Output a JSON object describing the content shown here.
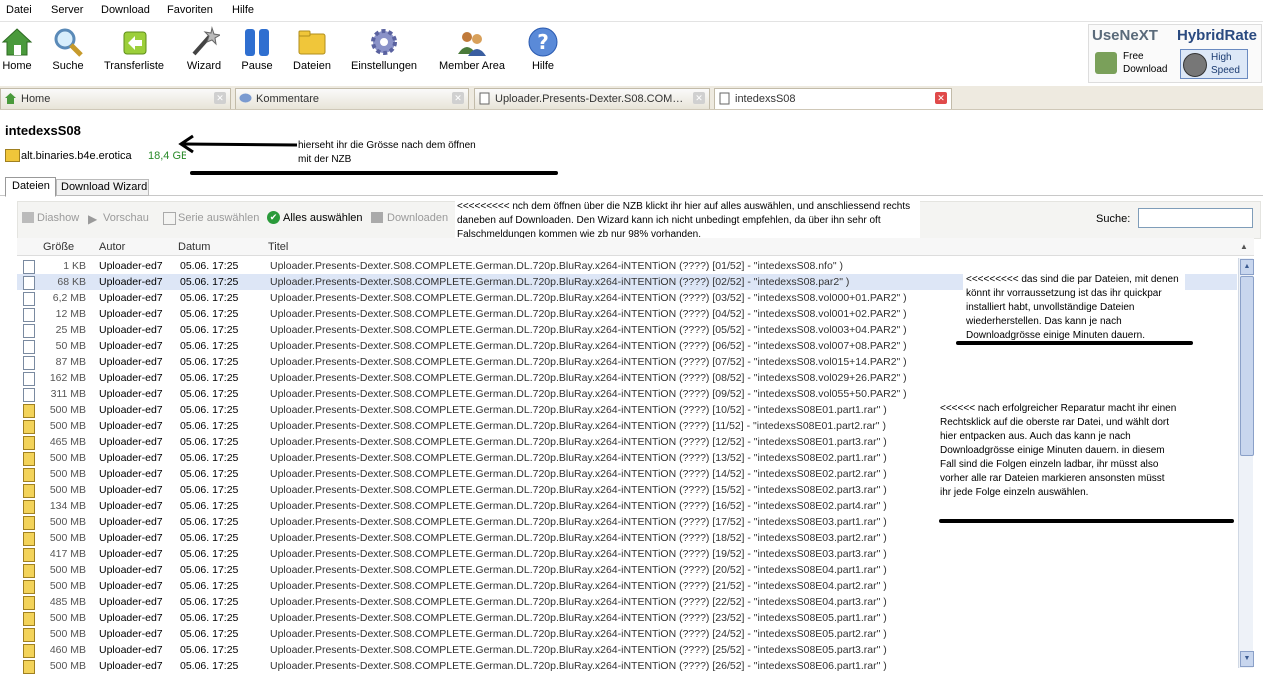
{
  "menu": [
    "Datei",
    "Server",
    "Download",
    "Favoriten",
    "Hilfe"
  ],
  "toolbar": {
    "home": "Home",
    "search": "Suche",
    "transfer": "Transferliste",
    "wizard": "Wizard",
    "pause": "Pause",
    "files": "Dateien",
    "settings": "Einstellungen",
    "member": "Member Area",
    "help": "Hilfe"
  },
  "brand": {
    "logo": "UseNeXT",
    "hybrid": "HybridRate",
    "free": "Free\nDownload",
    "high": "High\nSpeed"
  },
  "tabs": [
    "Home",
    "Kommentare",
    "Uploader.Presents-Dexter.S08.COM…",
    "intedexsS08"
  ],
  "page": {
    "title": "intedexsS08",
    "group": "alt.binaries.b4e.erotica",
    "size": "18,4 GB"
  },
  "subtabs": [
    "Dateien",
    "Download Wizard"
  ],
  "actions": {
    "slideshow": "Diashow",
    "preview": "Vorschau",
    "series": "Serie auswählen",
    "selectall": "Alles auswählen",
    "download": "Downloaden",
    "search_label": "Suche:"
  },
  "columns": {
    "size": "Größe",
    "author": "Autor",
    "date": "Datum",
    "title": "Titel"
  },
  "notes": {
    "size": "hierseht ihr die Grösse nach dem öffnen\nmit der NZB",
    "selectall": "<<<<<<<<< nch dem öffnen über die NZB klickt ihr hier auf alles auswählen, und anschliessend rechts daneben auf Downloaden. Den Wizard kann ich nicht unbedingt empfehlen, da über ihn sehr oft Falschmeldungen kommen wie zb nur 98% vorhanden.",
    "par": "<<<<<<<<< das sind die par Dateien, mit denen könnt ihr vorraussetzung ist das ihr quickpar installiert habt, unvollständige Dateien wiederherstellen. Das kann je nach Downloadgrösse einige Minuten dauern.",
    "rar": "<<<<<< nach erfolgreicher Reparatur macht ihr einen Rechtsklick auf die oberste rar Datei, und wählt dort hier entpacken aus. Auch das kann je nach Downloadgrösse einige Minuten dauern. in diesem Fall sind die  Folgen einzeln ladbar, ihr müsst also vorher alle rar Dateien markieren ansonsten müsst ihr jede Folge einzeln auswählen."
  },
  "rows": [
    {
      "size": "1 KB",
      "author": "Uploader-ed7",
      "date": "05.06. 17:25",
      "title": "Uploader.Presents-Dexter.S08.COMPLETE.German.DL.720p.BluRay.x264-iNTENTiON  (????)  [01/52]  -  \"intedexsS08.nfo\"  )",
      "type": "nfo"
    },
    {
      "size": "68 KB",
      "author": "Uploader-ed7",
      "date": "05.06. 17:25",
      "title": "Uploader.Presents-Dexter.S08.COMPLETE.German.DL.720p.BluRay.x264-iNTENTiON  (????)  [02/52]  -  \"intedexsS08.par2\"  )",
      "type": "par",
      "selected": true
    },
    {
      "size": "6,2 MB",
      "author": "Uploader-ed7",
      "date": "05.06. 17:25",
      "title": "Uploader.Presents-Dexter.S08.COMPLETE.German.DL.720p.BluRay.x264-iNTENTiON  (????)  [03/52]  -  \"intedexsS08.vol000+01.PAR2\"  )",
      "type": "par"
    },
    {
      "size": "12 MB",
      "author": "Uploader-ed7",
      "date": "05.06. 17:25",
      "title": "Uploader.Presents-Dexter.S08.COMPLETE.German.DL.720p.BluRay.x264-iNTENTiON  (????)  [04/52]  -  \"intedexsS08.vol001+02.PAR2\"  )",
      "type": "par"
    },
    {
      "size": "25 MB",
      "author": "Uploader-ed7",
      "date": "05.06. 17:25",
      "title": "Uploader.Presents-Dexter.S08.COMPLETE.German.DL.720p.BluRay.x264-iNTENTiON  (????)  [05/52]  -  \"intedexsS08.vol003+04.PAR2\"  )",
      "type": "par"
    },
    {
      "size": "50 MB",
      "author": "Uploader-ed7",
      "date": "05.06. 17:25",
      "title": "Uploader.Presents-Dexter.S08.COMPLETE.German.DL.720p.BluRay.x264-iNTENTiON  (????)  [06/52]  -  \"intedexsS08.vol007+08.PAR2\"  )",
      "type": "par"
    },
    {
      "size": "87 MB",
      "author": "Uploader-ed7",
      "date": "05.06. 17:25",
      "title": "Uploader.Presents-Dexter.S08.COMPLETE.German.DL.720p.BluRay.x264-iNTENTiON  (????)  [07/52]  -  \"intedexsS08.vol015+14.PAR2\"  )",
      "type": "par"
    },
    {
      "size": "162 MB",
      "author": "Uploader-ed7",
      "date": "05.06. 17:25",
      "title": "Uploader.Presents-Dexter.S08.COMPLETE.German.DL.720p.BluRay.x264-iNTENTiON  (????)  [08/52]  -  \"intedexsS08.vol029+26.PAR2\"  )",
      "type": "par"
    },
    {
      "size": "311 MB",
      "author": "Uploader-ed7",
      "date": "05.06. 17:25",
      "title": "Uploader.Presents-Dexter.S08.COMPLETE.German.DL.720p.BluRay.x264-iNTENTiON  (????)  [09/52]  -  \"intedexsS08.vol055+50.PAR2\"  )",
      "type": "par"
    },
    {
      "size": "500 MB",
      "author": "Uploader-ed7",
      "date": "05.06. 17:25",
      "title": "Uploader.Presents-Dexter.S08.COMPLETE.German.DL.720p.BluRay.x264-iNTENTiON  (????)  [10/52]  -  \"intedexsS08E01.part1.rar\"  )",
      "type": "rar"
    },
    {
      "size": "500 MB",
      "author": "Uploader-ed7",
      "date": "05.06. 17:25",
      "title": "Uploader.Presents-Dexter.S08.COMPLETE.German.DL.720p.BluRay.x264-iNTENTiON  (????)  [11/52]  -  \"intedexsS08E01.part2.rar\"  )",
      "type": "rar"
    },
    {
      "size": "465 MB",
      "author": "Uploader-ed7",
      "date": "05.06. 17:25",
      "title": "Uploader.Presents-Dexter.S08.COMPLETE.German.DL.720p.BluRay.x264-iNTENTiON  (????)  [12/52]  -  \"intedexsS08E01.part3.rar\"  )",
      "type": "rar"
    },
    {
      "size": "500 MB",
      "author": "Uploader-ed7",
      "date": "05.06. 17:25",
      "title": "Uploader.Presents-Dexter.S08.COMPLETE.German.DL.720p.BluRay.x264-iNTENTiON  (????)  [13/52]  -  \"intedexsS08E02.part1.rar\"  )",
      "type": "rar"
    },
    {
      "size": "500 MB",
      "author": "Uploader-ed7",
      "date": "05.06. 17:25",
      "title": "Uploader.Presents-Dexter.S08.COMPLETE.German.DL.720p.BluRay.x264-iNTENTiON  (????)  [14/52]  -  \"intedexsS08E02.part2.rar\"  )",
      "type": "rar"
    },
    {
      "size": "500 MB",
      "author": "Uploader-ed7",
      "date": "05.06. 17:25",
      "title": "Uploader.Presents-Dexter.S08.COMPLETE.German.DL.720p.BluRay.x264-iNTENTiON  (????)  [15/52]  -  \"intedexsS08E02.part3.rar\"  )",
      "type": "rar"
    },
    {
      "size": "134 MB",
      "author": "Uploader-ed7",
      "date": "05.06. 17:25",
      "title": "Uploader.Presents-Dexter.S08.COMPLETE.German.DL.720p.BluRay.x264-iNTENTiON  (????)  [16/52]  -  \"intedexsS08E02.part4.rar\"  )",
      "type": "rar"
    },
    {
      "size": "500 MB",
      "author": "Uploader-ed7",
      "date": "05.06. 17:25",
      "title": "Uploader.Presents-Dexter.S08.COMPLETE.German.DL.720p.BluRay.x264-iNTENTiON  (????)  [17/52]  -  \"intedexsS08E03.part1.rar\"  )",
      "type": "rar"
    },
    {
      "size": "500 MB",
      "author": "Uploader-ed7",
      "date": "05.06. 17:25",
      "title": "Uploader.Presents-Dexter.S08.COMPLETE.German.DL.720p.BluRay.x264-iNTENTiON  (????)  [18/52]  -  \"intedexsS08E03.part2.rar\"  )",
      "type": "rar"
    },
    {
      "size": "417 MB",
      "author": "Uploader-ed7",
      "date": "05.06. 17:25",
      "title": "Uploader.Presents-Dexter.S08.COMPLETE.German.DL.720p.BluRay.x264-iNTENTiON  (????)  [19/52]  -  \"intedexsS08E03.part3.rar\"  )",
      "type": "rar"
    },
    {
      "size": "500 MB",
      "author": "Uploader-ed7",
      "date": "05.06. 17:25",
      "title": "Uploader.Presents-Dexter.S08.COMPLETE.German.DL.720p.BluRay.x264-iNTENTiON  (????)  [20/52]  -  \"intedexsS08E04.part1.rar\"  )",
      "type": "rar"
    },
    {
      "size": "500 MB",
      "author": "Uploader-ed7",
      "date": "05.06. 17:25",
      "title": "Uploader.Presents-Dexter.S08.COMPLETE.German.DL.720p.BluRay.x264-iNTENTiON  (????)  [21/52]  -  \"intedexsS08E04.part2.rar\"  )",
      "type": "rar"
    },
    {
      "size": "485 MB",
      "author": "Uploader-ed7",
      "date": "05.06. 17:25",
      "title": "Uploader.Presents-Dexter.S08.COMPLETE.German.DL.720p.BluRay.x264-iNTENTiON  (????)  [22/52]  -  \"intedexsS08E04.part3.rar\"  )",
      "type": "rar"
    },
    {
      "size": "500 MB",
      "author": "Uploader-ed7",
      "date": "05.06. 17:25",
      "title": "Uploader.Presents-Dexter.S08.COMPLETE.German.DL.720p.BluRay.x264-iNTENTiON  (????)  [23/52]  -  \"intedexsS08E05.part1.rar\"  )",
      "type": "rar"
    },
    {
      "size": "500 MB",
      "author": "Uploader-ed7",
      "date": "05.06. 17:25",
      "title": "Uploader.Presents-Dexter.S08.COMPLETE.German.DL.720p.BluRay.x264-iNTENTiON  (????)  [24/52]  -  \"intedexsS08E05.part2.rar\"  )",
      "type": "rar"
    },
    {
      "size": "460 MB",
      "author": "Uploader-ed7",
      "date": "05.06. 17:25",
      "title": "Uploader.Presents-Dexter.S08.COMPLETE.German.DL.720p.BluRay.x264-iNTENTiON  (????)  [25/52]  -  \"intedexsS08E05.part3.rar\"  )",
      "type": "rar"
    },
    {
      "size": "500 MB",
      "author": "Uploader-ed7",
      "date": "05.06. 17:25",
      "title": "Uploader.Presents-Dexter.S08.COMPLETE.German.DL.720p.BluRay.x264-iNTENTiON  (????)  [26/52]  -  \"intedexsS08E06.part1.rar\"  )",
      "type": "rar"
    }
  ]
}
